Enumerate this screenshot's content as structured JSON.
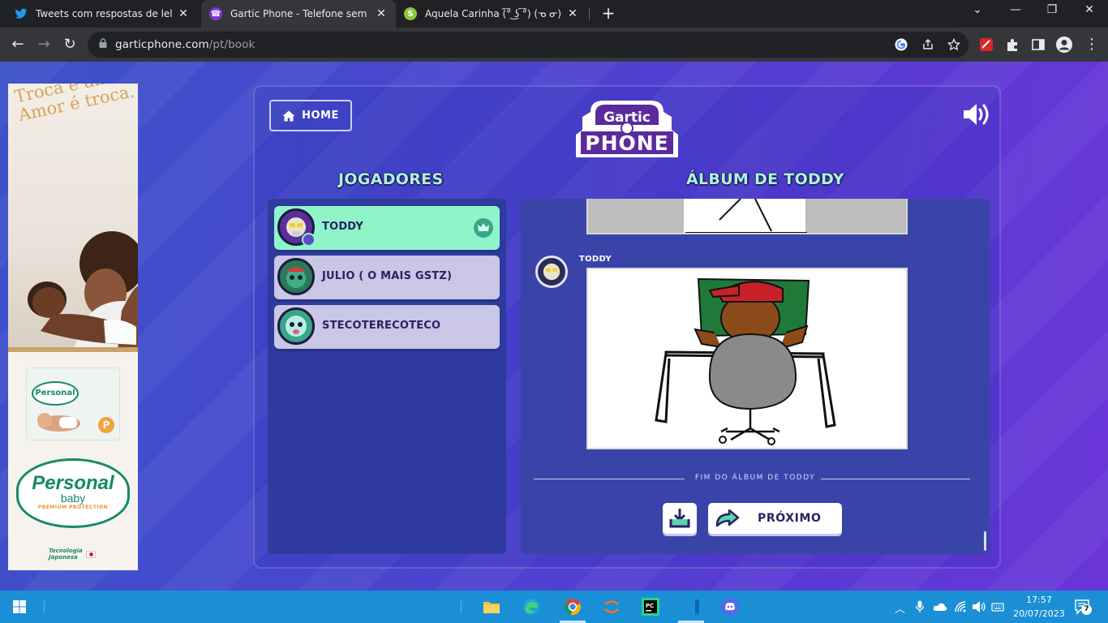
{
  "browser": {
    "tabs": [
      {
        "title": "Tweets com respostas de lelets (@",
        "favicon": "twitter-icon",
        "active": false
      },
      {
        "title": "Gartic Phone - Telefone sem fio",
        "favicon": "phone-icon",
        "active": true
      },
      {
        "title": "Aquela Carinha (͡° ͜ʖ ͡°) (ᓀ ᓂ) (",
        "favicon": "s-icon",
        "active": false
      }
    ],
    "url_host": "garticphone.com",
    "url_path": "/pt/book"
  },
  "ad": {
    "headline": "Troca é amor. Amor é troca.",
    "brand": "Personal",
    "sub_brand": "baby",
    "tagline": "PREMIUM PROTECTION",
    "tech": "Tecnologia Japonesa",
    "pack_label": "Personal",
    "pack_size": "P"
  },
  "game": {
    "home_label": "HOME",
    "logo_top": "Gartic",
    "logo_bottom": "PHONE",
    "players_title": "JOGADORES",
    "album_title": "ÁLBUM DE TODDY",
    "players": [
      {
        "name": "TODDY",
        "owner": true
      },
      {
        "name": "JULIO ( O MAIS GSTZ)",
        "owner": false
      },
      {
        "name": "STECOTERECOTECO",
        "owner": false
      }
    ],
    "album_author": "TODDY",
    "end_label": "FIM DO ÁLBUM DE TODDY",
    "next_label": "PRÓXIMO"
  },
  "taskbar": {
    "time": "17:57",
    "date": "20/07/2023",
    "notifications": "7"
  }
}
